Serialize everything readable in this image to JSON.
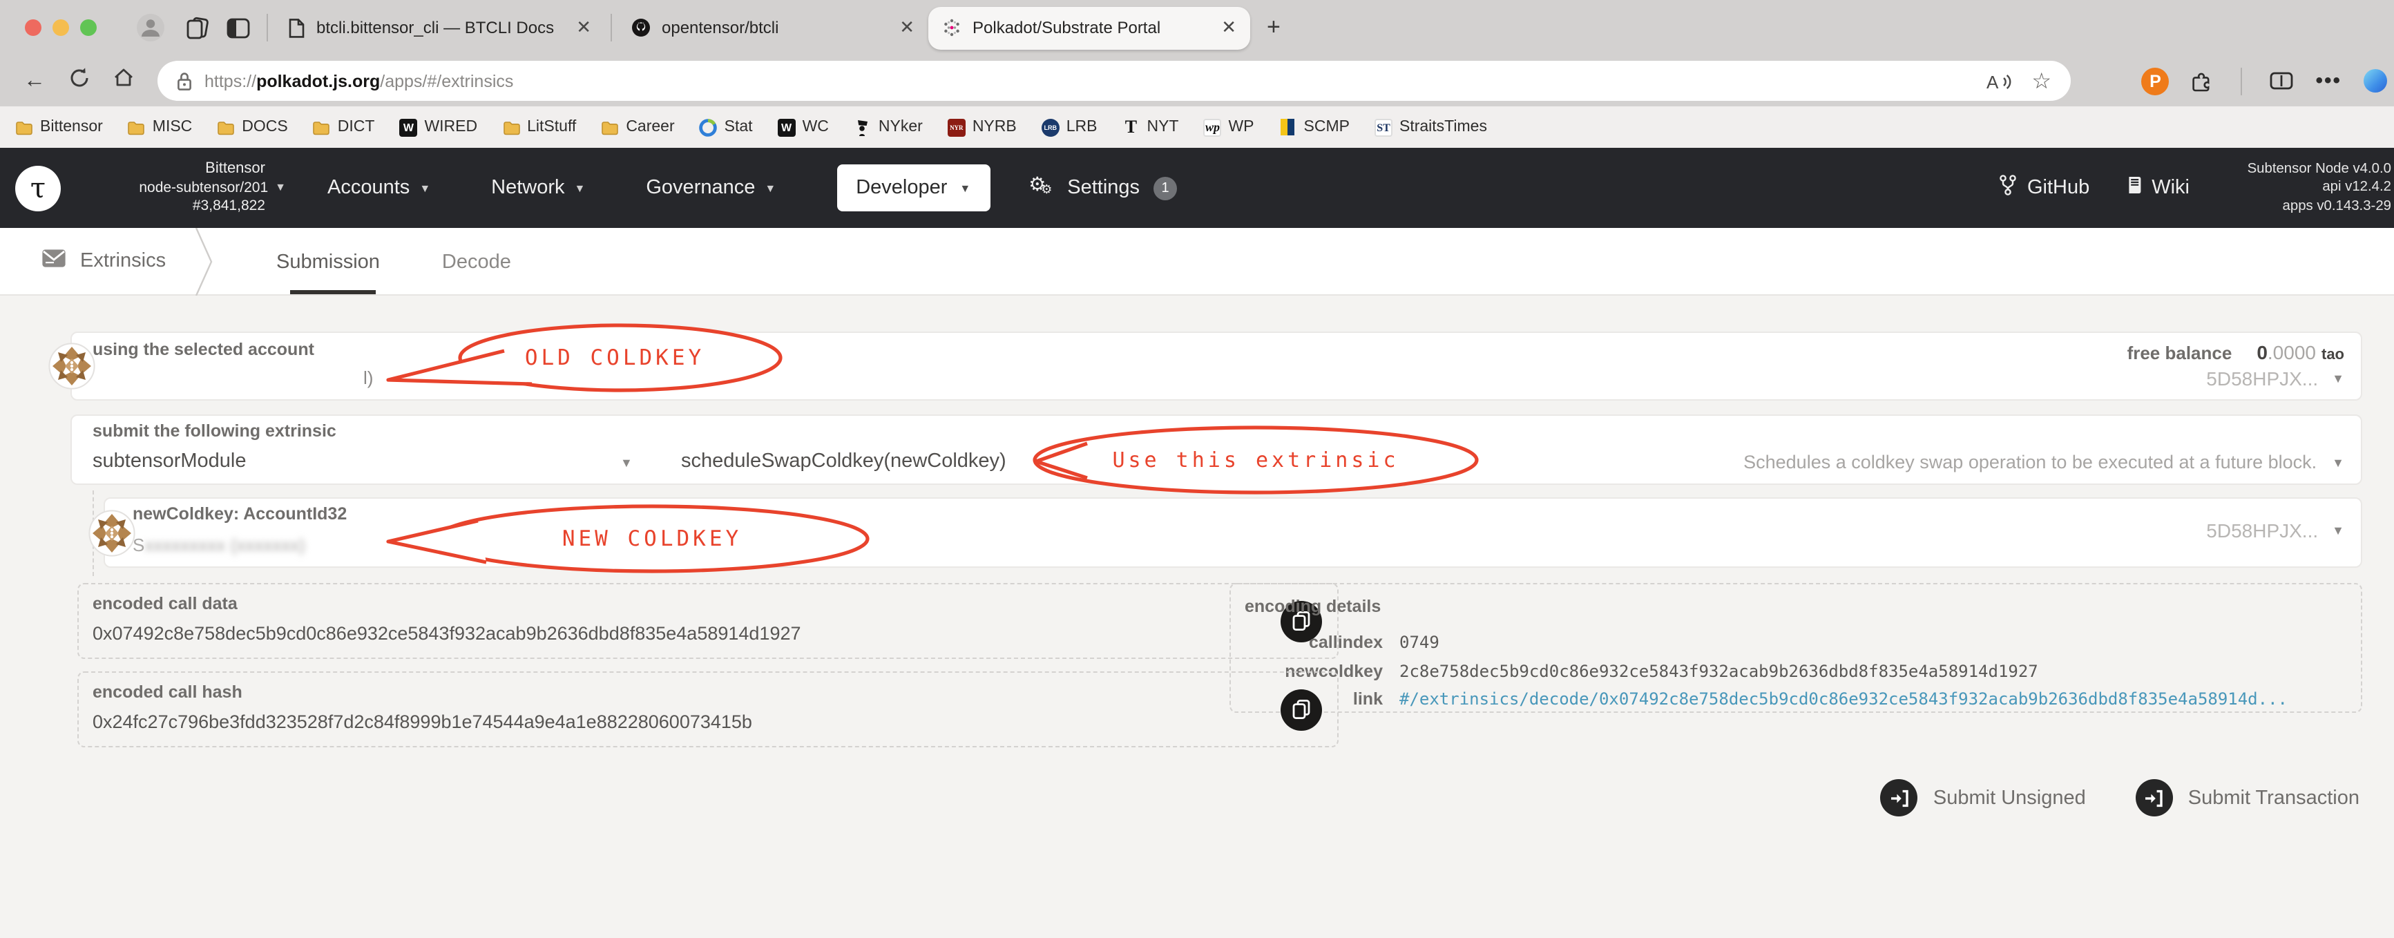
{
  "browser": {
    "tabs": [
      {
        "label": "btcli.bittensor_cli — BTCLI Docs",
        "icon": "document-icon"
      },
      {
        "label": "opentensor/btcli",
        "icon": "github-icon"
      },
      {
        "label": "Polkadot/Substrate Portal",
        "icon": "polkadot-icon"
      }
    ],
    "url": {
      "scheme": "https://",
      "host": "polkadot.js.org",
      "path": "/apps/#/extrinsics"
    },
    "bookmarks": [
      {
        "label": "Bittensor",
        "icon": "folder-icon"
      },
      {
        "label": "MISC",
        "icon": "folder-icon"
      },
      {
        "label": "DOCS",
        "icon": "folder-icon"
      },
      {
        "label": "DICT",
        "icon": "folder-icon"
      },
      {
        "label": "WIRED",
        "icon": "wired-icon"
      },
      {
        "label": "LitStuff",
        "icon": "folder-icon"
      },
      {
        "label": "Career",
        "icon": "folder-icon"
      },
      {
        "label": "Stat",
        "icon": "stat-icon"
      },
      {
        "label": "WC",
        "icon": "wc-icon"
      },
      {
        "label": "NYker",
        "icon": "newyorker-icon"
      },
      {
        "label": "NYRB",
        "icon": "nyrb-icon"
      },
      {
        "label": "LRB",
        "icon": "lrb-icon"
      },
      {
        "label": "NYT",
        "icon": "nyt-icon"
      },
      {
        "label": "WP",
        "icon": "wp-icon"
      },
      {
        "label": "SCMP",
        "icon": "scmp-icon"
      },
      {
        "label": "StraitsTimes",
        "icon": "straitstimes-icon"
      }
    ],
    "icon_short": {
      "nyrb": "NYR",
      "lrb": "LRB",
      "nyt": "T",
      "wp": "wp",
      "st": "ST",
      "w": "W",
      "p": "P"
    }
  },
  "header": {
    "chain": {
      "name": "Bittensor",
      "node": "node-subtensor/201",
      "block": "#3,841,822"
    },
    "nav": [
      {
        "label": "Accounts"
      },
      {
        "label": "Network"
      },
      {
        "label": "Governance"
      },
      {
        "label": "Developer"
      }
    ],
    "settings": {
      "label": "Settings",
      "badge": "1"
    },
    "links": [
      {
        "label": "GitHub"
      },
      {
        "label": "Wiki"
      }
    ],
    "version_lines": [
      "Subtensor Node v4.0.0",
      "api v12.4.2",
      "apps v0.143.3-29"
    ]
  },
  "strip": {
    "section": "Extrinsics",
    "tabs": [
      {
        "label": "Submission"
      },
      {
        "label": "Decode"
      }
    ]
  },
  "form": {
    "account": {
      "label": "using the selected account",
      "visible_name": "l)",
      "free_balance_label": "free balance",
      "balance_int": "0",
      "balance_frac": ".0000",
      "balance_unit": "tao",
      "address_short": "5D58HPJX..."
    },
    "extrinsic": {
      "label": "submit the following extrinsic",
      "module": "subtensorModule",
      "method": "scheduleSwapColdkey(newColdkey)",
      "description": "Schedules a coldkey swap operation to be executed at a future block."
    },
    "new_coldkey": {
      "label": "newColdkey: AccountId32",
      "masked_prefix": "S",
      "masked_rest": "xxxxxxxxx (xxxxxxx)",
      "address_short": "5D58HPJX..."
    },
    "encoded_call_data": {
      "label": "encoded call data",
      "value": "0x07492c8e758dec5b9cd0c86e932ce5843f932acab9b2636dbd8f835e4a58914d1927"
    },
    "encoded_call_hash": {
      "label": "encoded call hash",
      "value": "0x24fc27c796be3fdd323528f7d2c84f8999b1e74544a9e4a1e88228060073415b"
    },
    "encoding_details": {
      "label": "encoding details",
      "rows": [
        {
          "key": "callindex",
          "value": "0749"
        },
        {
          "key": "newcoldkey",
          "value": "2c8e758dec5b9cd0c86e932ce5843f932acab9b2636dbd8f835e4a58914d1927"
        },
        {
          "key": "link",
          "value": "#/extrinsics/decode/0x07492c8e758dec5b9cd0c86e932ce5843f932acab9b2636dbd8f835e4a58914d..."
        }
      ]
    },
    "actions": [
      {
        "label": "Submit Unsigned"
      },
      {
        "label": "Submit Transaction"
      }
    ]
  },
  "annotations": [
    {
      "text": "OLD COLDKEY"
    },
    {
      "text": "Use this extrinsic"
    },
    {
      "text": "NEW COLDKEY"
    }
  ],
  "colors": {
    "annotation_red": "#E8432C",
    "link_blue": "#4897BA",
    "header_bg": "#26272B",
    "extension_orange": "#EF7B1A",
    "polkadot_pink": "#E6007A"
  }
}
